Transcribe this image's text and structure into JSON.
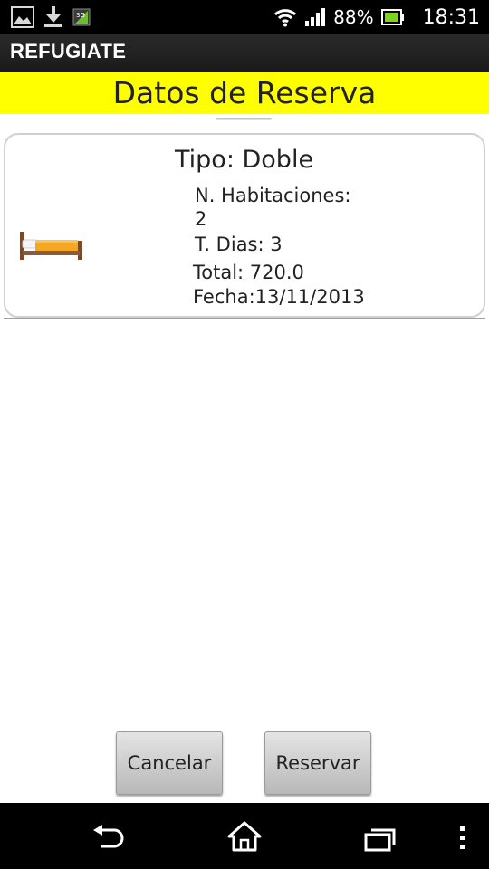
{
  "status_bar": {
    "icons_left": [
      "image-icon",
      "download-icon",
      "3g-icon"
    ],
    "icons_right": [
      "wifi-icon",
      "signal-icon",
      "battery-icon"
    ],
    "battery": "88%",
    "time": "18:31"
  },
  "action_bar": {
    "title": "REFUGIATE"
  },
  "header": {
    "title": "Datos de Reserva",
    "background": "#ffff00"
  },
  "reservation": {
    "icon": "bed-icon",
    "type": "Tipo: Doble",
    "rooms_label": "N. Habitaciones:",
    "rooms_value": "2",
    "days": "T. Dias: 3",
    "total": "Total: 720.0",
    "date": "Fecha:13/11/2013"
  },
  "buttons": {
    "cancel": "Cancelar",
    "reserve": "Reservar"
  },
  "nav_bar": {
    "icons": [
      "back-icon",
      "home-icon",
      "recent-apps-icon",
      "menu-icon"
    ]
  }
}
